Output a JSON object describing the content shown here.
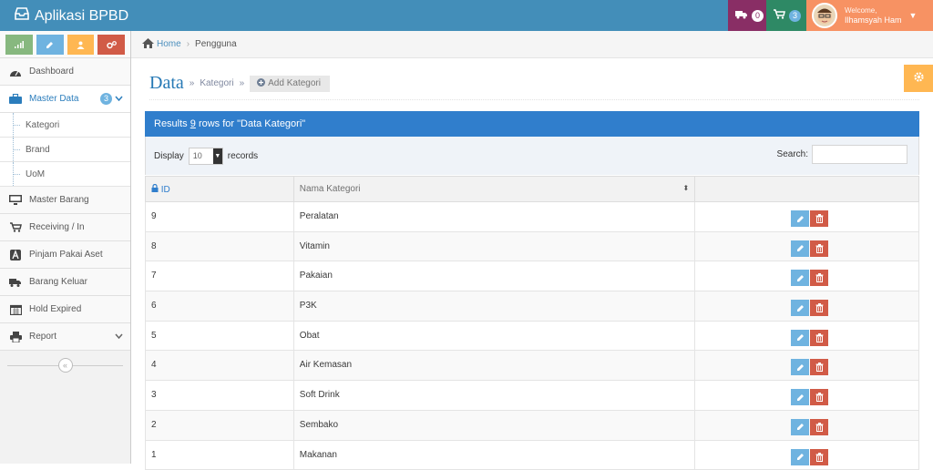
{
  "app": {
    "title": "Aplikasi BPBD"
  },
  "navbar": {
    "truck_count": "0",
    "cart_count": "3",
    "welcome_label": "Welcome,",
    "user_name": "Ilhamsyah Ham"
  },
  "sidebar": {
    "shortcuts": [
      {
        "name": "chart-icon",
        "color": "#87b87f"
      },
      {
        "name": "pencil-icon",
        "color": "#6fb3e0"
      },
      {
        "name": "user-icon",
        "color": "#ffb752"
      },
      {
        "name": "cogs-icon",
        "color": "#d15b47"
      }
    ],
    "items": [
      {
        "label": "Dashboard",
        "icon": "dashboard-icon"
      },
      {
        "label": "Master Data",
        "icon": "briefcase-icon",
        "badge": "3"
      },
      {
        "label": "Master Barang",
        "icon": "desktop-icon"
      },
      {
        "label": "Receiving / In",
        "icon": "cart-icon"
      },
      {
        "label": "Pinjam Pakai Aset",
        "icon": "text-icon"
      },
      {
        "label": "Barang Keluar",
        "icon": "truck-icon"
      },
      {
        "label": "Hold Expired",
        "icon": "calendar-icon"
      },
      {
        "label": "Report",
        "icon": "print-icon"
      }
    ],
    "sub_items": [
      "Kategori",
      "Brand",
      "UoM"
    ]
  },
  "breadcrumb": {
    "home": "Home",
    "current": "Pengguna"
  },
  "page": {
    "title": "Data",
    "subtitle": "Kategori",
    "add_label": "Add Kategori"
  },
  "results": {
    "prefix": "Results",
    "count": "9",
    "suffix": "rows for \"Data Kategori\""
  },
  "controls": {
    "display_label": "Display",
    "display_value": "10",
    "records_label": "records",
    "search_label": "Search:"
  },
  "table": {
    "columns": [
      "ID",
      "Nama Kategori",
      ""
    ],
    "rows": [
      {
        "id": "9",
        "name": "Peralatan"
      },
      {
        "id": "8",
        "name": "Vitamin"
      },
      {
        "id": "7",
        "name": "Pakaian"
      },
      {
        "id": "6",
        "name": "P3K"
      },
      {
        "id": "5",
        "name": "Obat"
      },
      {
        "id": "4",
        "name": "Air Kemasan"
      },
      {
        "id": "3",
        "name": "Soft Drink"
      },
      {
        "id": "2",
        "name": "Sembako"
      },
      {
        "id": "1",
        "name": "Makanan"
      }
    ]
  },
  "colors": {
    "navbar": "#438eb9",
    "results_bar": "#307ecc",
    "edit": "#6fb3e0",
    "delete": "#d15b47"
  }
}
